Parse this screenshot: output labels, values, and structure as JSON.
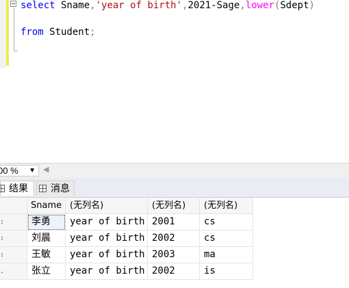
{
  "editor": {
    "line1": {
      "kw_select": "select",
      "col_sname": " Sname",
      "comma1": ",",
      "str_literal": "'year of birth'",
      "comma2": ",",
      "expr": "2021-Sage",
      "comma3": ",",
      "fn_lower": "lower",
      "paren_open": "(",
      "arg": "Sdept",
      "paren_close": ")"
    },
    "line2": {
      "kw_from": "from",
      "table": " Student",
      "semicolon": ";"
    }
  },
  "status": {
    "zoom": "00 %",
    "zoom_caret": "▼",
    "scroll_arrow": "◀"
  },
  "tabs": [
    {
      "label": "结果"
    },
    {
      "label": "消息"
    }
  ],
  "grid": {
    "columns": [
      "Sname",
      "(无列名)",
      "(无列名)",
      "(无列名)"
    ],
    "row_markers": [
      ":",
      ":",
      ":",
      "."
    ],
    "rows": [
      [
        "李勇",
        "year of birth",
        "2001",
        "cs"
      ],
      [
        "刘晨",
        "year of birth",
        "2002",
        "cs"
      ],
      [
        "王敏",
        "year of birth",
        "2003",
        "ma"
      ],
      [
        "张立",
        "year of birth",
        "2002",
        "is"
      ]
    ]
  }
}
